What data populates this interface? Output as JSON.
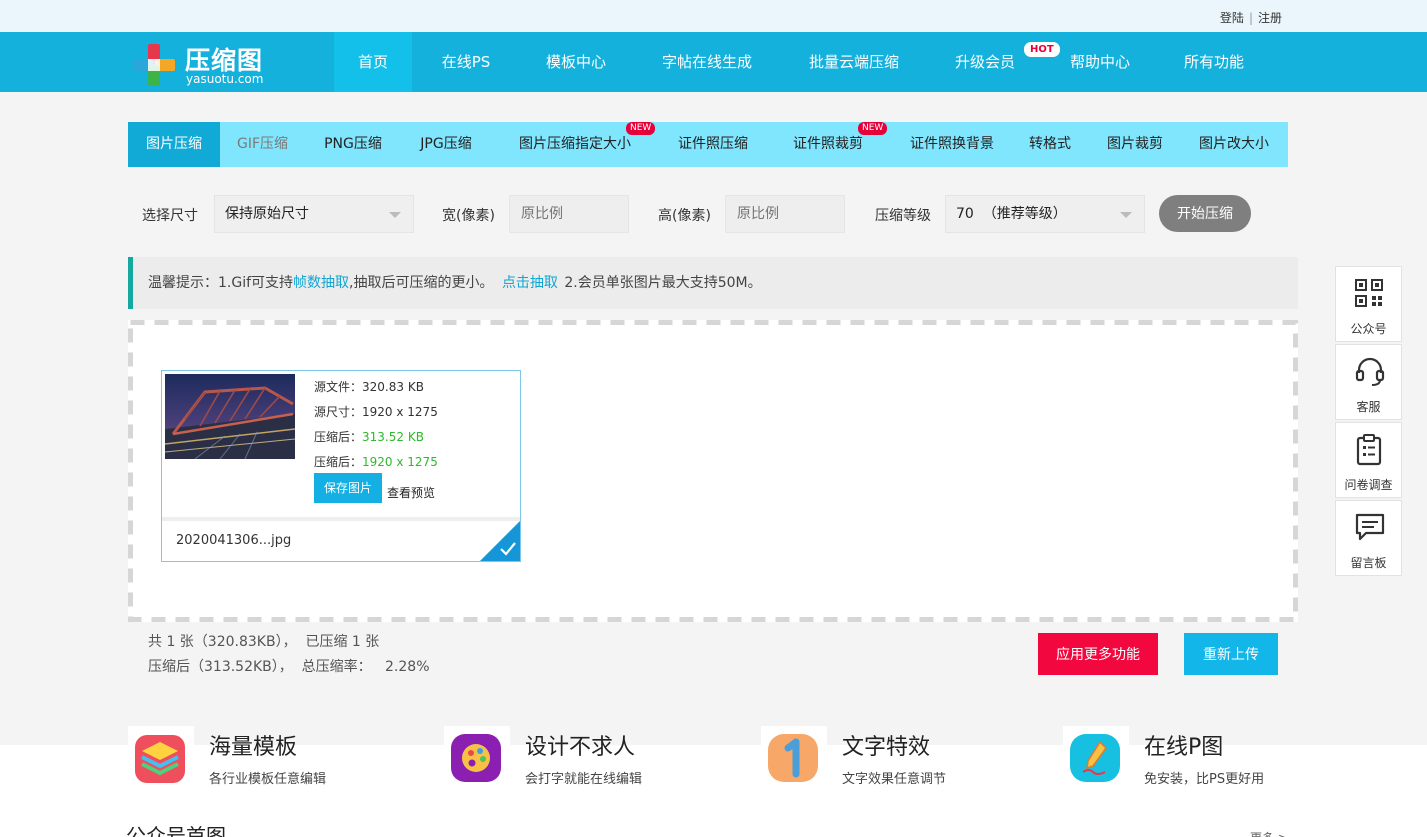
{
  "top_links": {
    "login": "登陆",
    "separator": "|",
    "register": "注册"
  },
  "logo": {
    "title": "压缩图",
    "subtitle": "yasuotu.com"
  },
  "nav": {
    "items": [
      {
        "label": "首页"
      },
      {
        "label": "在线PS"
      },
      {
        "label": "模板中心"
      },
      {
        "label": "字帖在线生成"
      },
      {
        "label": "批量云端压缩"
      },
      {
        "label": "升级会员"
      },
      {
        "label": "帮助中心"
      },
      {
        "label": "所有功能"
      }
    ],
    "hot_badge": "HOT"
  },
  "tabs": {
    "items": [
      {
        "label": "图片压缩"
      },
      {
        "label": "GIF压缩"
      },
      {
        "label": "PNG压缩"
      },
      {
        "label": "JPG压缩"
      },
      {
        "label": "图片压缩指定大小"
      },
      {
        "label": "证件照压缩"
      },
      {
        "label": "证件照裁剪"
      },
      {
        "label": "证件照换背景"
      },
      {
        "label": "转格式"
      },
      {
        "label": "图片裁剪"
      },
      {
        "label": "图片改大小"
      }
    ],
    "new_badge": "NEW"
  },
  "controls": {
    "size_label": "选择尺寸",
    "size_value": "保持原始尺寸",
    "width_label": "宽(像素)",
    "width_placeholder": "原比例",
    "height_label": "高(像素)",
    "height_placeholder": "原比例",
    "level_label": "压缩等级",
    "level_value": "70  （推荐等级）",
    "start_button": "开始压缩"
  },
  "tip": {
    "prefix": "温馨提示：1.Gif可支持",
    "link1": "帧数抽取",
    "middle": ",抽取后可压缩的更小。",
    "link2": "点击抽取",
    "suffix": "2.会员单张图片最大支持50M。"
  },
  "file_card": {
    "src_file_label": "源文件：",
    "src_file_value": "320.83 KB",
    "src_size_label": "源尺寸：",
    "src_size_value": "1920 x 1275",
    "out_file_label": "压缩后：",
    "out_file_value": "313.52 KB",
    "out_size_label": "压缩后：",
    "out_size_value": "1920 x 1275",
    "save_button": "保存图片",
    "preview_link": "查看预览",
    "filename": "2020041306...jpg"
  },
  "stats": {
    "line1": "共 1 张（320.83KB），  已压缩 1 张",
    "line2": "压缩后（313.52KB），  总压缩率：   2.28%"
  },
  "actions": {
    "more_button": "应用更多功能",
    "reupload_button": "重新上传"
  },
  "features": [
    {
      "title": "海量模板",
      "desc": "各行业模板任意编辑",
      "icon": "layers-icon"
    },
    {
      "title": "设计不求人",
      "desc": "会打字就能在线编辑",
      "icon": "palette-icon"
    },
    {
      "title": "文字特效",
      "desc": "文字效果任意调节",
      "icon": "number-one-icon"
    },
    {
      "title": "在线P图",
      "desc": "免安装，比PS更好用",
      "icon": "pencil-icon"
    }
  ],
  "section": {
    "title": "公众号首图",
    "more": "更多 >"
  },
  "sidebar": [
    {
      "label": "公众号",
      "icon": "qrcode-icon"
    },
    {
      "label": "客服",
      "icon": "headset-icon"
    },
    {
      "label": "问卷调查",
      "icon": "clipboard-icon"
    },
    {
      "label": "留言板",
      "icon": "message-icon"
    }
  ],
  "colors": {
    "header": "#15b1dd",
    "tabs": "#80e6fd",
    "tab_active": "#11a9d6",
    "tip_border": "#14a89e",
    "accent_red": "#f2083e",
    "accent_blue": "#12b6e8",
    "success_green": "#2fb92c"
  }
}
